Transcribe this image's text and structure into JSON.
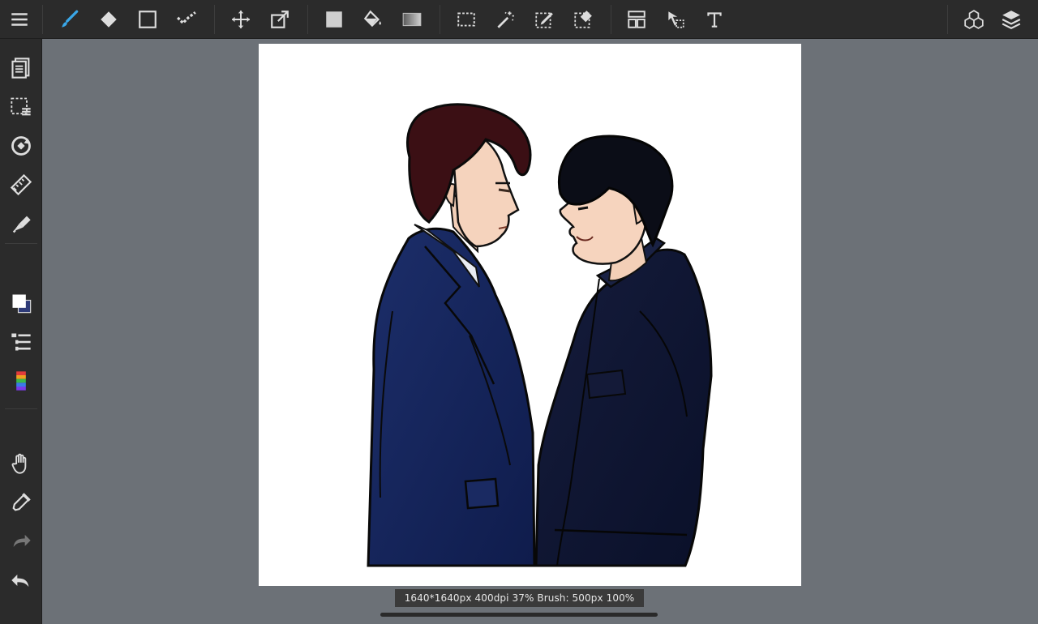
{
  "app": {
    "status_text": "1640*1640px 400dpi 37% Brush: 500px 100%"
  },
  "toolbar": {
    "accent_color": "#3aa7e8",
    "items": [
      "menu-icon",
      "brush-icon",
      "eraser-icon",
      "rectangle-icon",
      "smudge-icon",
      "move-icon",
      "transform-icon",
      "fill-color-icon",
      "bucket-icon",
      "gradient-icon",
      "select-rect-icon",
      "magic-wand-icon",
      "select-pen-icon",
      "select-eraser-icon",
      "layout-icon",
      "select-arrow-icon",
      "text-icon",
      "materials-icon",
      "layers-icon"
    ]
  },
  "sidebar": {
    "items": [
      "pages-icon",
      "selection-layer-icon",
      "rotate-icon",
      "ruler-icon",
      "filter-icon",
      "color-swatch-icon",
      "layer-list-icon",
      "color-palette-icon",
      "hand-icon",
      "eyedropper-icon",
      "redo-icon",
      "undo-icon"
    ],
    "foreground_color": "#ffffff",
    "background_color": "#2e3b78"
  },
  "canvas": {
    "background": "#ffffff"
  }
}
